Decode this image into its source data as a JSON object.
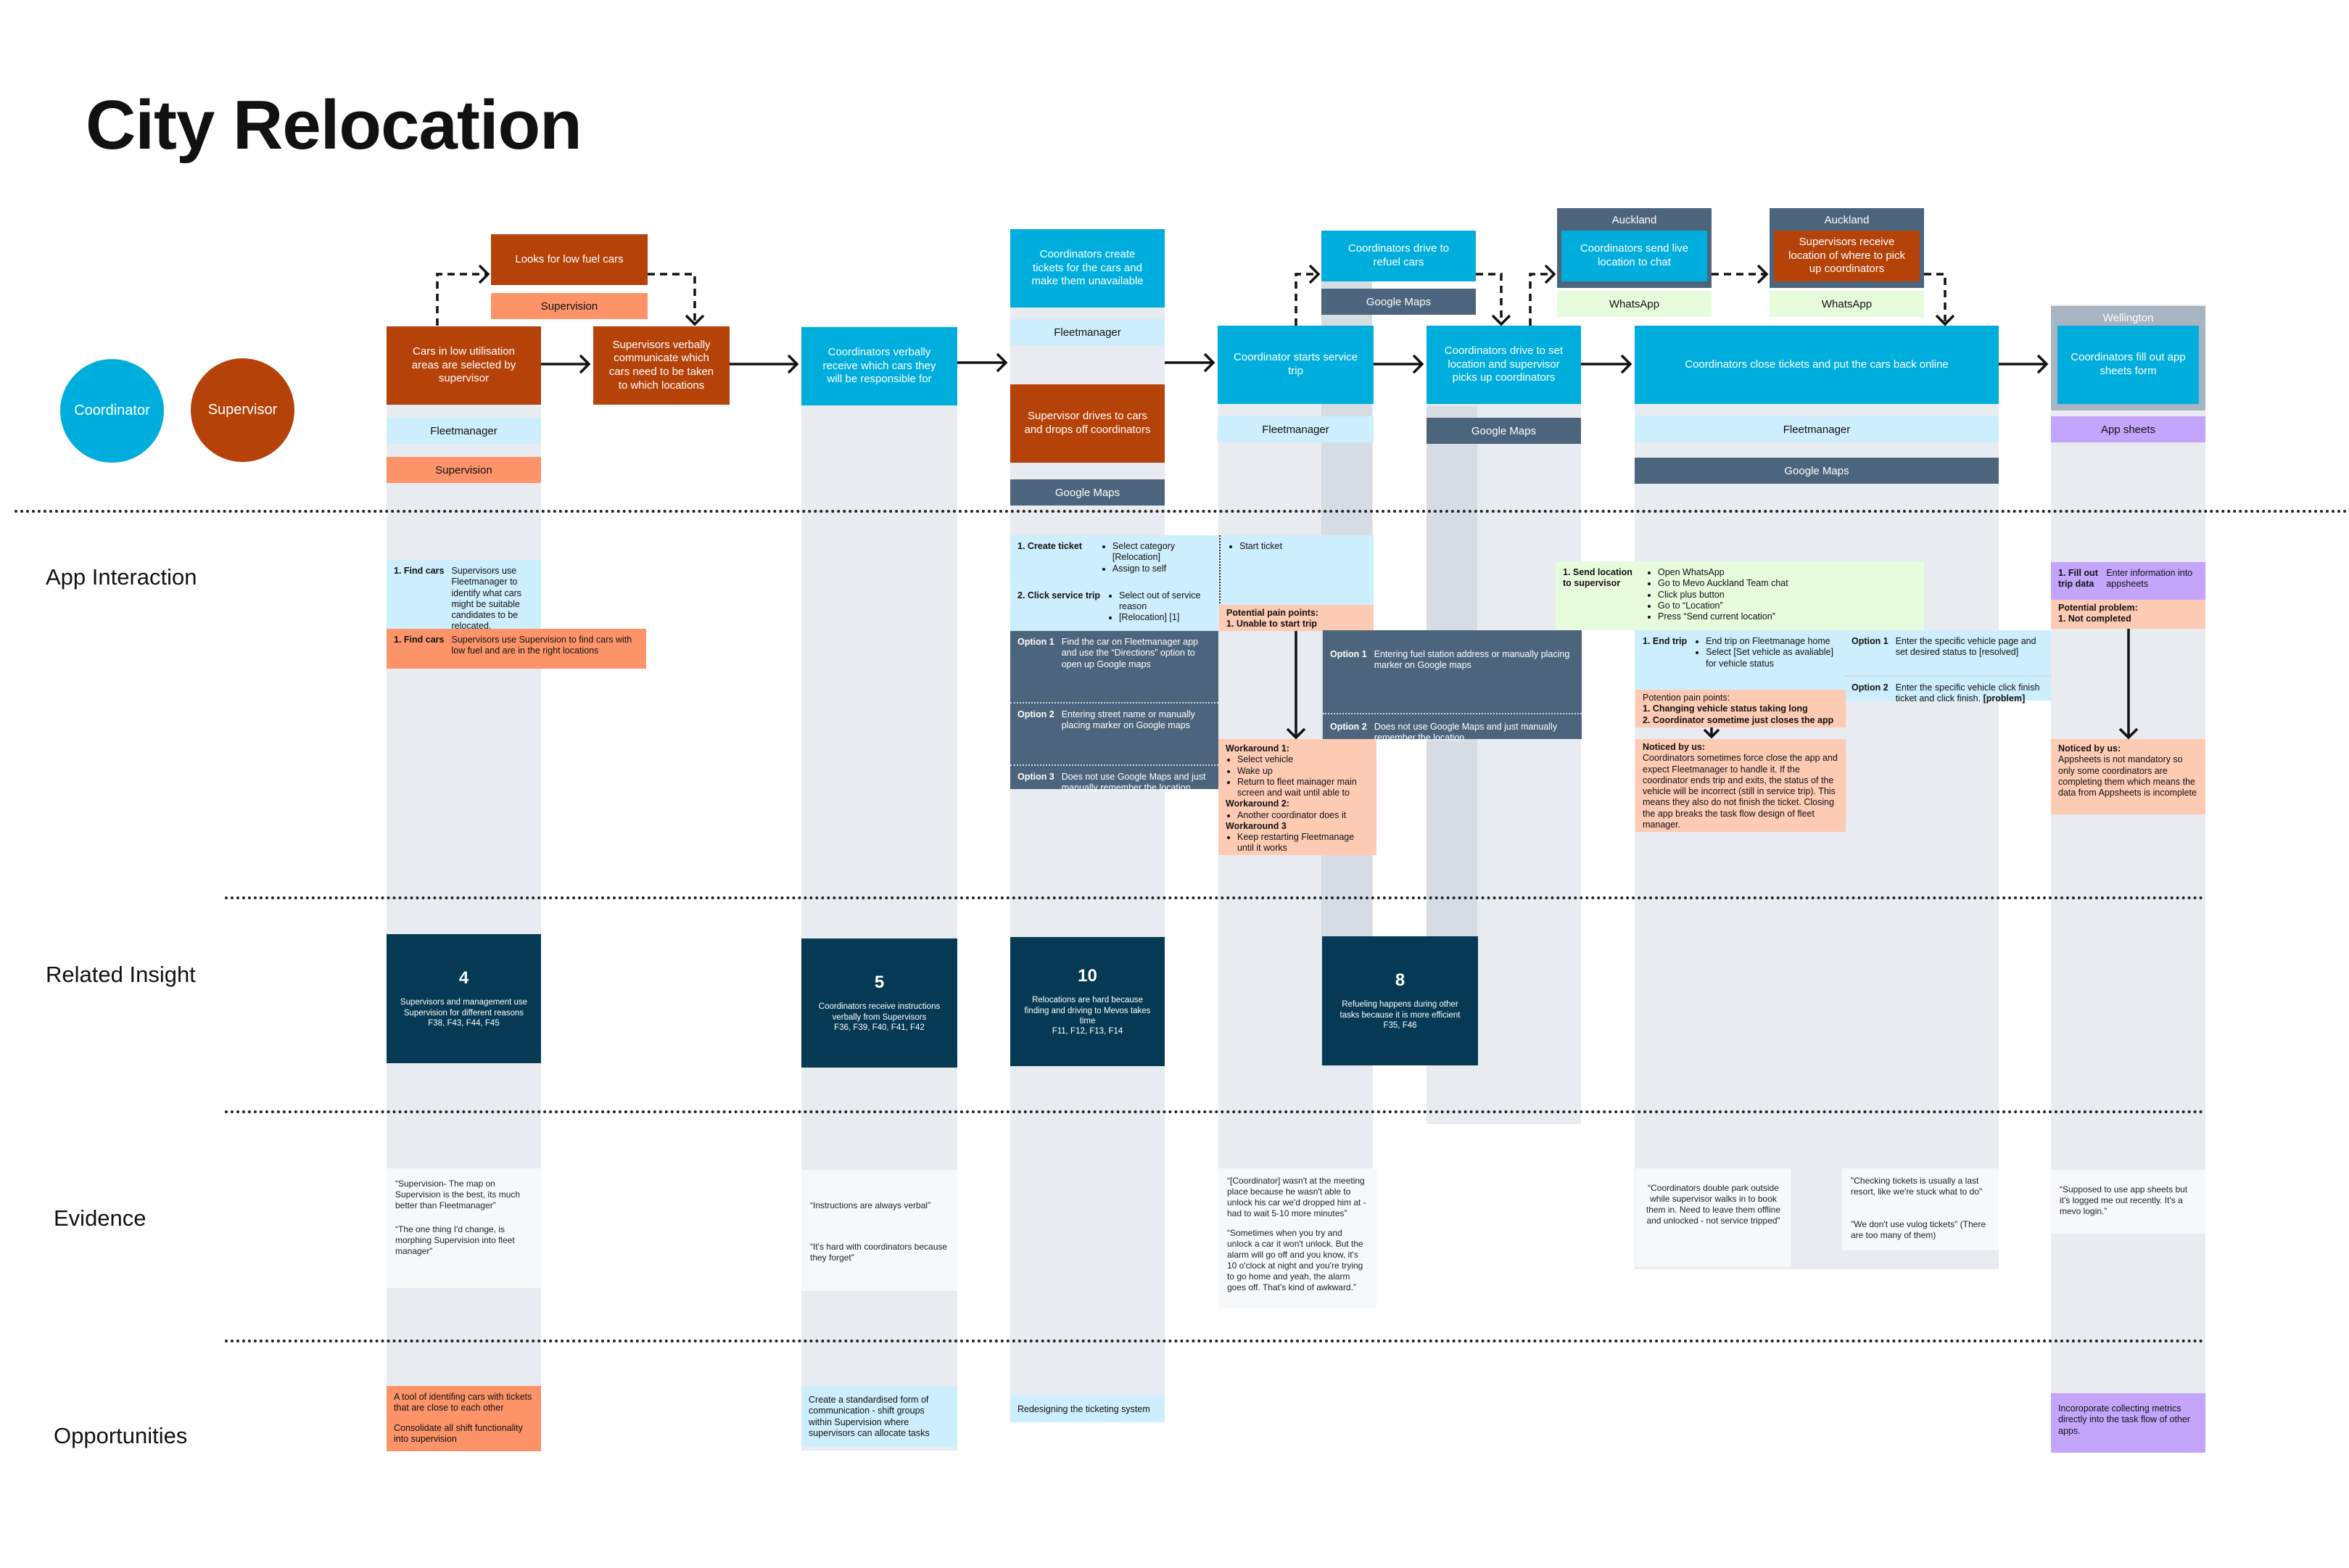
{
  "title": "City Relocation",
  "legend": [
    {
      "label": "Coordinator",
      "color": "#00aede"
    },
    {
      "label": "Supervisor",
      "color": "#b54208"
    }
  ],
  "row_labels": {
    "app_interaction": "App Interaction",
    "related_insight": "Related Insight",
    "evidence": "Evidence",
    "opportunities": "Opportunities"
  },
  "steps": {
    "low_fuel": {
      "text": "Looks for low fuel cars",
      "tool": "Supervision"
    },
    "select_cars": {
      "text": "Cars in low utilisation areas are selected by supervisor",
      "tools": [
        "Fleetmanager",
        "Supervision"
      ]
    },
    "verbal_communicate": {
      "text": "Supervisors verbally communicate which cars need to be taken to which locations"
    },
    "verbal_receive": {
      "text": "Coordinators verbally receive which cars they will be responsible for"
    },
    "create_tickets": {
      "text": "Coordinators create tickets for the cars and make them unavailable",
      "tool": "Fleetmanager"
    },
    "drop_off": {
      "text": "Supervisor drives to cars and drops off coordinators",
      "tool": "Google Maps"
    },
    "start_trip": {
      "text": "Coordinator starts service trip",
      "tool": "Fleetmanager"
    },
    "refuel": {
      "text": "Coordinators drive to refuel cars",
      "tool": "Google Maps"
    },
    "drive_set_location": {
      "text": "Coordinators drive to set location and supervisor picks up coordinators",
      "tool": "Google Maps"
    },
    "send_live": {
      "city": "Auckland",
      "text": "Coordinators send live location to chat",
      "tool": "WhatsApp"
    },
    "receive_location": {
      "city": "Auckland",
      "text": "Supervisors receive location of where to pick up coordinators",
      "tool": "WhatsApp"
    },
    "close_tickets": {
      "text": "Coordinators close tickets and put the cars back online",
      "tools": [
        "Fleetmanager",
        "Google Maps"
      ]
    },
    "app_sheets": {
      "city": "Wellington",
      "text": "Coordinators fill out app sheets form",
      "tool": "App sheets"
    }
  },
  "interactions": {
    "find_cars_fm": {
      "key": "1. Find cars",
      "text": "Supervisors use Fleetmanager to identify what cars might be suitable candidates to be relocated."
    },
    "find_cars_sv": {
      "key": "1. Find cars",
      "text": "Supervisors use Supervision to find cars with low fuel and are in the right locations"
    },
    "create_ticket": {
      "key": "1. Create ticket",
      "items": [
        "Select category [Relocation]",
        "Assign to self"
      ]
    },
    "click_service_trip": {
      "key": "2. Click service trip",
      "items": [
        "Select out of service reason",
        "[Relocation] [1]"
      ]
    },
    "nav_options": [
      {
        "key": "Option 1",
        "text": "Find the car on Fleetmanager app and use the “Directions” option to open up Google maps"
      },
      {
        "key": "Option 2",
        "text": "Entering street name or manually placing marker on Google maps"
      },
      {
        "key": "Option 3",
        "text": "Does not use Google Maps and just manually remember the location"
      }
    ],
    "start_ticket": {
      "items": [
        "Start ticket"
      ]
    },
    "start_pain": {
      "heading": "Potential pain points:",
      "items": [
        "1. Unable to start trip"
      ]
    },
    "workarounds": [
      {
        "heading": "Workaround 1:",
        "items": [
          "Select vehicle",
          "Wake up",
          "Return to fleet mainager main screen and wait until able to"
        ]
      },
      {
        "heading": "Workaround 2:",
        "items": [
          "Another coordinator does it"
        ]
      },
      {
        "heading": "Workaround 3",
        "items": [
          "Keep restarting Fleetmanage until it works"
        ]
      }
    ],
    "refuel_options": [
      {
        "key": "Option 1",
        "text": "Entering fuel station address or manually placing marker on Google maps"
      },
      {
        "key": "Option 2",
        "text": "Does not use Google Maps and just manually remember the location"
      }
    ],
    "send_location": {
      "key": "1. Send location to supervisor",
      "items": [
        "Open WhatsApp",
        "Go to Mevo Auckland Team chat",
        "Click plus button",
        "Go to “Location”",
        "Press “Send current location”"
      ]
    },
    "end_trip": {
      "key": "1. End trip",
      "items": [
        "End trip on Fleetmanage home",
        "Select [Set vehicle as avaliable] for vehicle status"
      ]
    },
    "end_options": [
      {
        "key": "Option 1",
        "text": "Enter the specific vehicle page and set desired status to [resolved]"
      },
      {
        "key": "Option 2",
        "text": "Enter the specific vehicle click finish ticket and click finish.",
        "bold": "[problem]"
      }
    ],
    "end_pain": {
      "heading": "Potention pain points:",
      "items": [
        "1. Changing vehicle status taking long",
        "2. Coordinator sometime just closes the app"
      ]
    },
    "end_noticed": {
      "heading": "Noticed by us:",
      "text": "Coordinators sometimes force close the app and expect Fleetmanager to handle it. If the coordinator ends trip and exits, the status of the vehicle will be incorrect (still in service trip). This means they also do not finish the ticket. Closing the app breaks the task flow design of fleet manager."
    },
    "fill_trip": {
      "key": "1. Fill out trip data",
      "text": "Enter information into appsheets"
    },
    "fill_problem": {
      "heading": "Potential problem:",
      "items": [
        "1. Not completed"
      ]
    },
    "fill_noticed": {
      "heading": "Noticed by us:",
      "text": "Appsheets is not mandatory so only some coordinators are completing them which means the data from Appsheets is incomplete"
    }
  },
  "insights": [
    {
      "number": "4",
      "text": "Supervisors and management use Supervision for different reasons",
      "refs": "F38, F43, F44, F45"
    },
    {
      "number": "5",
      "text": "Coordinators receive instructions verbally from Supervisors",
      "refs": "F36, F39, F40, F41, F42"
    },
    {
      "number": "10",
      "text": "Relocations are hard because finding and driving to Mevos takes time",
      "refs": "F11, F12, F13, F14"
    },
    {
      "number": "8",
      "text": "Refueling happens during other tasks because it is more efficient",
      "refs": "F35, F46"
    }
  ],
  "evidence": {
    "col1": [
      "“Supervision- The map on Supervision is the best, its much better than Fleetmanager”",
      "“The one thing I'd change, is morphing Supervision into fleet manager”"
    ],
    "col2": [
      "“Instructions are always verbal”",
      "“It's hard with coordinators because they forget”"
    ],
    "col4": [
      "“[Coordinator] wasn't at the meeting place because he wasn't able to unlock his car we'd dropped him at - had to wait 5-10 more minutes”",
      "“Sometimes when you try and unlock a car it won't unlock. But the alarm will go off and  you know, it's  10 o'clock at night and you're trying to go home and yeah, the alarm goes off. That's kind of awkward.”"
    ],
    "col6a": [
      "“Coordinators double park outside while supervisor walks in to book them in. Need to leave them offline and unlocked - not service tripped”"
    ],
    "col6b": [
      "\"Checking tickets is usually a last resort, like we're stuck what to do\"",
      "\"We don't use vulog tickets\" (There are too many of them)"
    ],
    "col7": [
      "“Supposed to use app sheets but it's logged me out recently. It's a mevo login.”"
    ]
  },
  "opportunities": {
    "col1": [
      "A tool of identifing cars with tickets that are close to each other",
      "Consolidate all shift functionality into supervision"
    ],
    "col2": [
      "Create a standardised form of communication - shift groups within Supervision where supervisors can allocate tasks"
    ],
    "col3": [
      "Redesigning the ticketing system"
    ],
    "col7": [
      "Incoroporate collecting metrics directly into the task flow of other apps."
    ]
  }
}
